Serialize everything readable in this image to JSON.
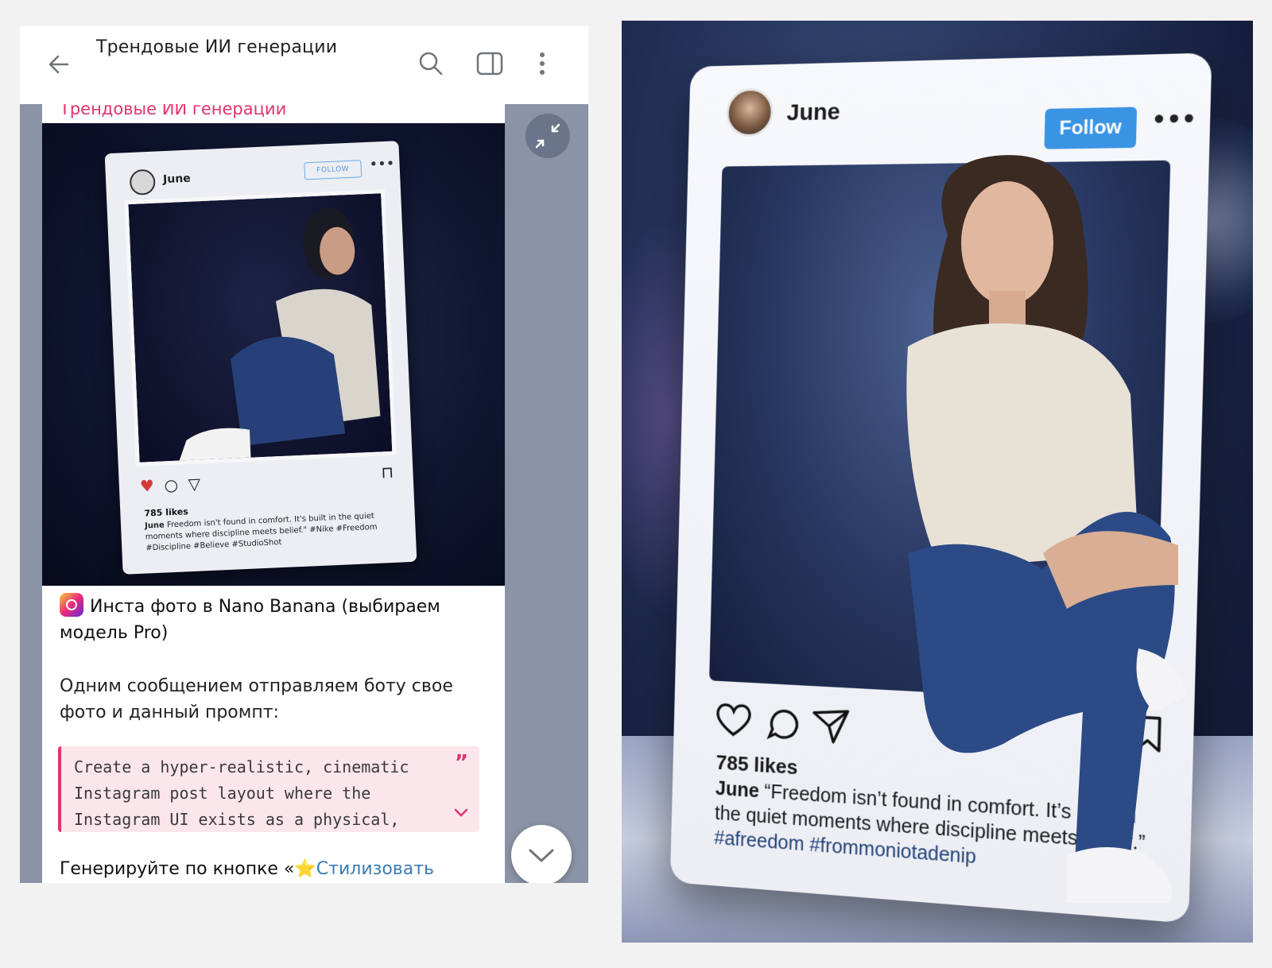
{
  "header": {
    "title": "Трендовые ИИ генерации"
  },
  "message": {
    "channel_name": "Трендовые ИИ генерации",
    "headline": "Инста фото в Nano Banana (выбираем модель Pro)",
    "body": "Одним сообщением отправляем боту свое фото и данный промпт:",
    "prompt_line_1": "Create a hyper-realistic, cinematic",
    "prompt_line_2": "Instagram post layout where the",
    "prompt_line_3": "Instagram UI exists as a physical,",
    "footer_text": "Генерируйте по кнопке «",
    "footer_link": "Стилизовать",
    "footer_emoji": "⭐"
  },
  "mini_post": {
    "username": "June",
    "follow_label": "FOLLOW",
    "likes": "785 likes",
    "caption_user": "June",
    "caption": "Freedom isn't found in comfort. It's built in the quiet moments where discipline meets belief.\" #Nike #Freedom #Discipline #Believe #StudioShot"
  },
  "big_post": {
    "username": "June",
    "follow_label": "Follow",
    "more_label": "•••",
    "likes": "785 likes",
    "caption_user": "June",
    "caption": "“Freedom isn’t found in comfort. It’s built in the quiet moments where discipline meets belief.”",
    "hashtags": "#afreedom #frommoniotadenip"
  },
  "colors": {
    "accent_pink": "#e2336a",
    "link_blue": "#3c7bb5",
    "follow_blue": "#3a94e4",
    "chat_bg": "#8a94a6"
  }
}
